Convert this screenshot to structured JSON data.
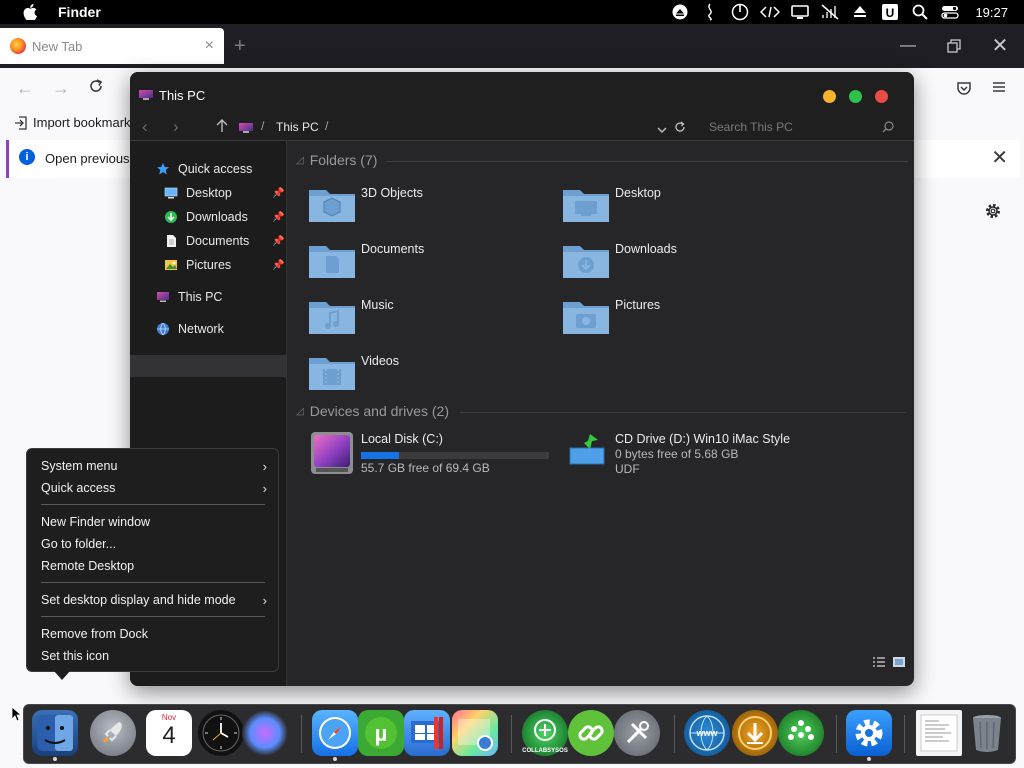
{
  "menubar": {
    "app_name": "Finder",
    "clock": "19:27"
  },
  "browser": {
    "tab_title": "New Tab",
    "bookmark_import": "Import bookmarks",
    "info_text": "Open previous ta"
  },
  "explorer": {
    "title": "This PC",
    "breadcrumb": "This PC",
    "search_placeholder": "Search This PC",
    "sidebar": [
      {
        "label": "Quick access",
        "icon": "star-icon"
      },
      {
        "label": "Desktop",
        "icon": "desktop-icon",
        "pinned": true
      },
      {
        "label": "Downloads",
        "icon": "downloads-icon",
        "pinned": true
      },
      {
        "label": "Documents",
        "icon": "documents-icon",
        "pinned": true
      },
      {
        "label": "Pictures",
        "icon": "pictures-icon",
        "pinned": true
      },
      {
        "label": "This PC",
        "icon": "computer-icon",
        "selected": true
      },
      {
        "label": "Network",
        "icon": "network-icon"
      }
    ],
    "folders_heading": "Folders (7)",
    "folders": [
      {
        "name": "3D Objects",
        "icon": "3d-objects-icon"
      },
      {
        "name": "Desktop",
        "icon": "desktop-folder-icon"
      },
      {
        "name": "Documents",
        "icon": "documents-folder-icon"
      },
      {
        "name": "Downloads",
        "icon": "downloads-folder-icon"
      },
      {
        "name": "Music",
        "icon": "music-folder-icon"
      },
      {
        "name": "Pictures",
        "icon": "pictures-folder-icon"
      },
      {
        "name": "Videos",
        "icon": "videos-folder-icon"
      }
    ],
    "drives_heading": "Devices and drives (2)",
    "drives": [
      {
        "name": "Local Disk (C:)",
        "detail": "55.7 GB free of 69.4 GB",
        "used_fraction": 0.2
      },
      {
        "name": "CD Drive (D:) Win10 iMac Style",
        "detail": "0 bytes free of 5.68 GB",
        "fs": "UDF"
      }
    ]
  },
  "context_menu": {
    "items": [
      {
        "label": "System menu",
        "submenu": true
      },
      {
        "label": "Quick access",
        "submenu": true
      },
      {
        "label": "New Finder window"
      },
      {
        "label": "Go to folder..."
      },
      {
        "label": "Remote Desktop"
      },
      {
        "label": "Set desktop display and hide mode",
        "submenu": true
      },
      {
        "label": "Remove from Dock"
      },
      {
        "label": "Set this icon"
      }
    ],
    "arrow_glyph": "›"
  },
  "dock": {
    "calendar_month": "Nov",
    "calendar_day": "4",
    "collab_label": "COLLABSYSOS"
  },
  "colors": {
    "accent": "#1673e6",
    "close": "#ec4b48",
    "minimize": "#f3b52a",
    "maximize": "#2fc24a"
  }
}
